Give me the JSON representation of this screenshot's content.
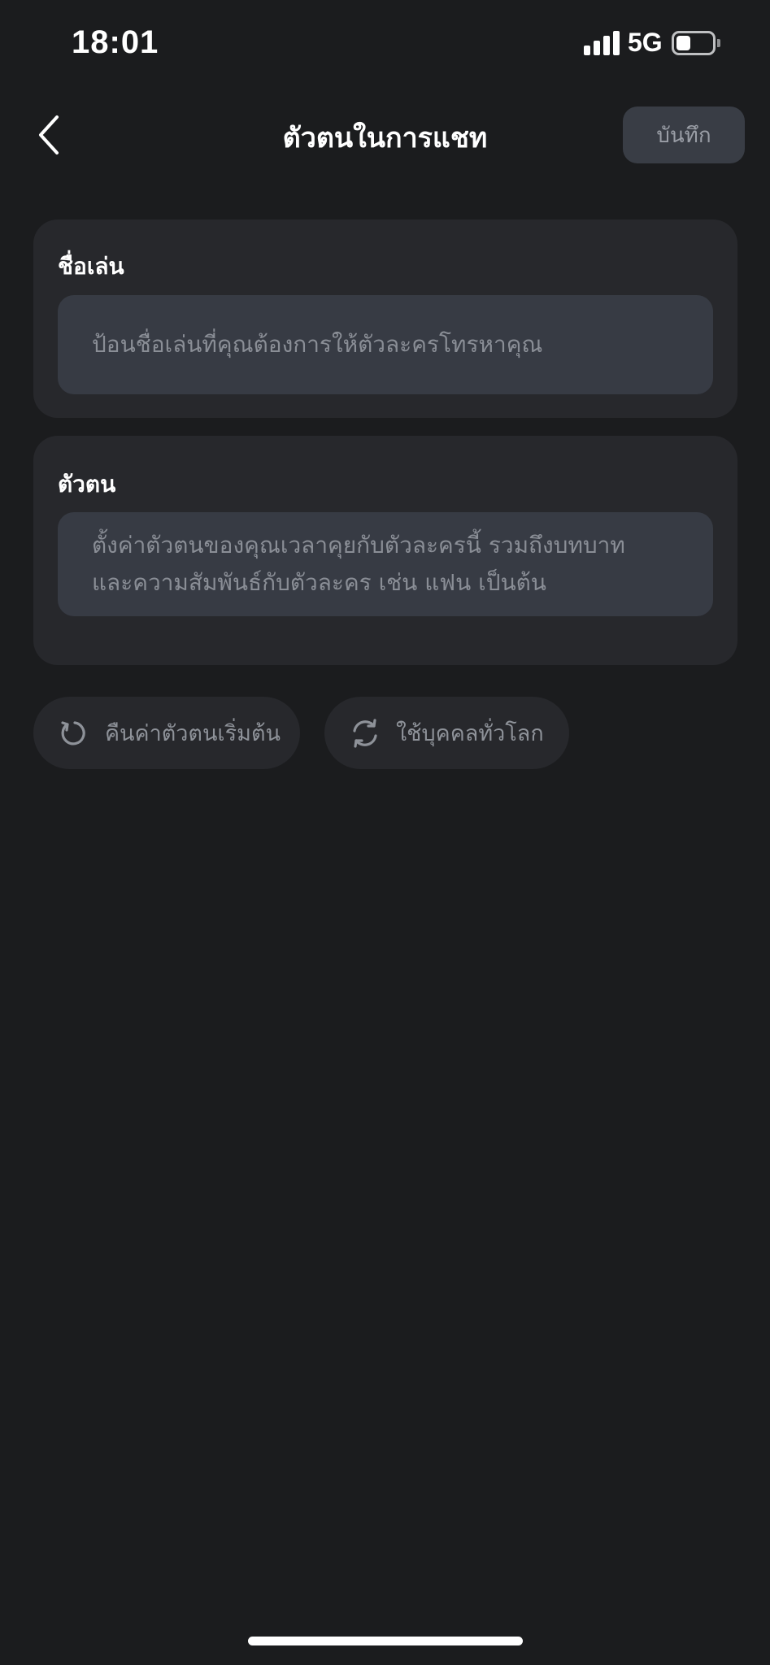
{
  "status_bar": {
    "time": "18:01",
    "network": "5G",
    "battery_level": 0.4
  },
  "header": {
    "back_icon": "chevron-left-icon",
    "title": "ตัวตนในการแชท",
    "save_label": "บันทึก"
  },
  "nickname_section": {
    "label": "ชื่อเล่น",
    "value": "",
    "placeholder": "ป้อนชื่อเล่นที่คุณต้องการให้ตัวละครโทรหาคุณ"
  },
  "persona_section": {
    "label": "ตัวตน",
    "value": "",
    "placeholder_line1": "ตั้งค่าตัวตนของคุณเวลาคุยกับตัวละครนี้ รวมถึงบทบาท",
    "placeholder_line2": "และความสัมพันธ์กับตัวละคร เช่น แฟน เป็นต้น"
  },
  "actions": {
    "reset": {
      "icon": "reset-icon",
      "label": "คืนค่าตัวตนเริ่มต้น"
    },
    "use_global": {
      "icon": "sync-icon",
      "label": "ใช้บุคคลทั่วโลก"
    }
  },
  "colors": {
    "background": "#1b1c1e",
    "card": "#27282c",
    "input": "#373b44",
    "placeholder_text": "#8a8e96",
    "primary_text": "#ffffff"
  }
}
